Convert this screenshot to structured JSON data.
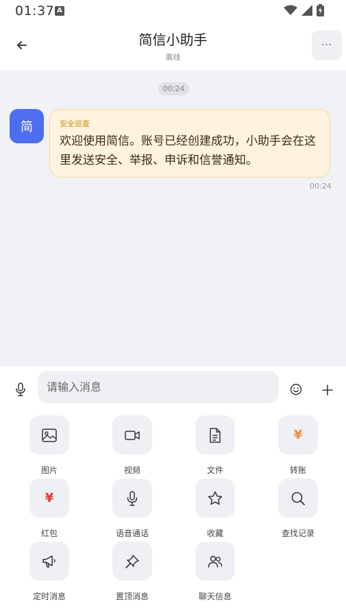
{
  "status": {
    "time": "01:37",
    "notification_glyph": "A"
  },
  "header": {
    "title": "简信小助手",
    "subtitle": "离线",
    "more_label": "···"
  },
  "chat": {
    "time_divider": "00:24",
    "avatar_text": "简",
    "message": {
      "tag": "安全巡查",
      "text": "欢迎使用简信。账号已经创建成功，小助手会在这里发送安全、举报、申诉和信誉通知。",
      "time": "00:24"
    }
  },
  "composer": {
    "placeholder": "请输入消息"
  },
  "tools": [
    {
      "label": "图片",
      "icon": "image-icon"
    },
    {
      "label": "视频",
      "icon": "video-icon"
    },
    {
      "label": "文件",
      "icon": "file-icon"
    },
    {
      "label": "转账",
      "icon": "yen-icon",
      "glyph": "¥",
      "color": "#f08a3c"
    },
    {
      "label": "红包",
      "icon": "red-packet-icon",
      "glyph": "¥",
      "color": "#e53935"
    },
    {
      "label": "语音通话",
      "icon": "microphone-icon"
    },
    {
      "label": "收藏",
      "icon": "star-icon"
    },
    {
      "label": "查找记录",
      "icon": "search-icon"
    },
    {
      "label": "定时消息",
      "icon": "megaphone-icon"
    },
    {
      "label": "置顶消息",
      "icon": "pin-icon"
    },
    {
      "label": "聊天信息",
      "icon": "people-icon"
    }
  ],
  "colors": {
    "accent": "#4e6ef2",
    "bubble_bg": "#fdf3df",
    "tag": "#c98a18"
  }
}
